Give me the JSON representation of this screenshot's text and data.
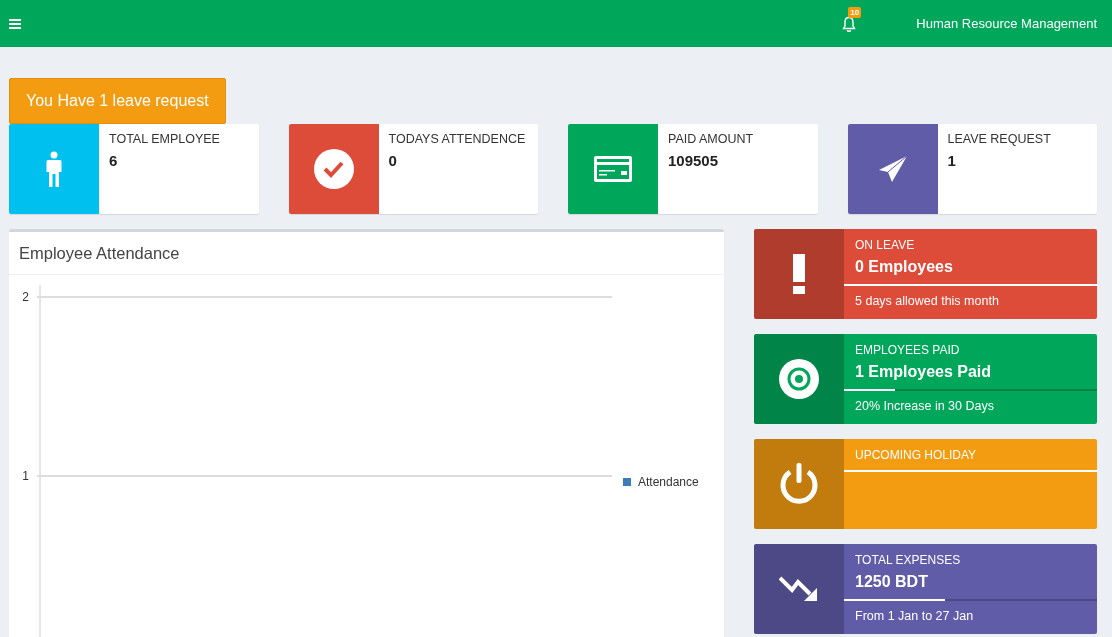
{
  "topbar": {
    "title": "Human Resource Management",
    "notification_count": "10"
  },
  "alert": {
    "label": "You Have 1 leave request"
  },
  "stat_cards": [
    {
      "label": "TOTAL EMPLOYEE",
      "value": "6",
      "color": "#00c0ef"
    },
    {
      "label": "TODAYS ATTENDENCE",
      "value": "0",
      "color": "#dd4b39"
    },
    {
      "label": "PAID AMOUNT",
      "value": "109505",
      "color": "#00a65a"
    },
    {
      "label": "LEAVE REQUEST",
      "value": "1",
      "color": "#605ca8"
    }
  ],
  "chart_panel": {
    "title": "Employee Attendance",
    "chart_data": {
      "type": "line",
      "ylim": [
        0,
        2
      ],
      "yticks": [
        1,
        2
      ],
      "series": [
        {
          "name": "Attendance",
          "color": "#3d7ab8"
        }
      ]
    }
  },
  "info_boxes": [
    {
      "title": "ON LEAVE",
      "number": "0 Employees",
      "level": 1,
      "description": "5 days allowed this month",
      "color": "#dd4b39"
    },
    {
      "title": "EMPLOYEES PAID",
      "number": "1 Employees Paid",
      "level": 0.2,
      "description": "20% Increase in 30 Days",
      "color": "#00a65a"
    },
    {
      "title": "UPCOMING HOLIDAY",
      "level": 1,
      "color": "#f39c12"
    },
    {
      "title": "TOTAL EXPENSES",
      "number": "1250 BDT",
      "level": 0.4,
      "description": "From 1 Jan to 27 Jan",
      "color": "#605ca8"
    }
  ]
}
